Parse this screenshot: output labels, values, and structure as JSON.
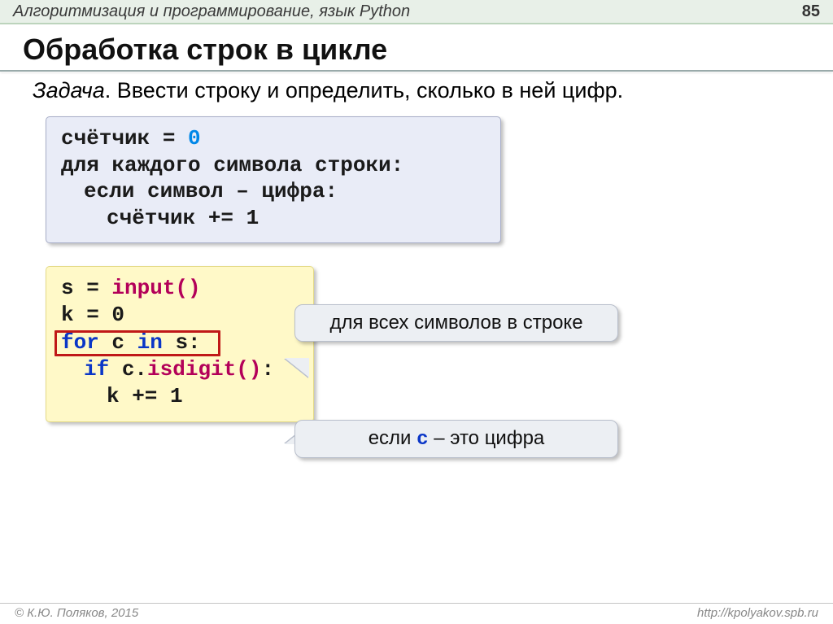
{
  "header": {
    "title": "Алгоритмизация и программирование, язык Python",
    "page": "85"
  },
  "title": "Обработка строк в цикле",
  "task_label": "Задача",
  "task_text": ". Ввести строку и определить, сколько в ней цифр.",
  "pseudo": {
    "l1_a": "счётчик = ",
    "l1_b": "0",
    "l2": "для каждого символа строки:",
    "l3": "если символ – цифра:",
    "l4": "счётчик += 1"
  },
  "code": {
    "l1_a": "s = ",
    "l1_b": "input()",
    "l2": "k = 0",
    "l3_a": "for",
    "l3_b": " c ",
    "l3_c": "in",
    "l3_d": " s:",
    "l4_a": "if",
    "l4_b": " c.",
    "l4_c": "isdigit()",
    "l4_d": ":",
    "l5": "k += 1"
  },
  "callout1": "для всех символов в строке",
  "callout2_a": "если ",
  "callout2_b": "c",
  "callout2_c": " – это цифра",
  "footer": {
    "left": "© К.Ю. Поляков, 2015",
    "right": "http://kpolyakov.spb.ru"
  }
}
